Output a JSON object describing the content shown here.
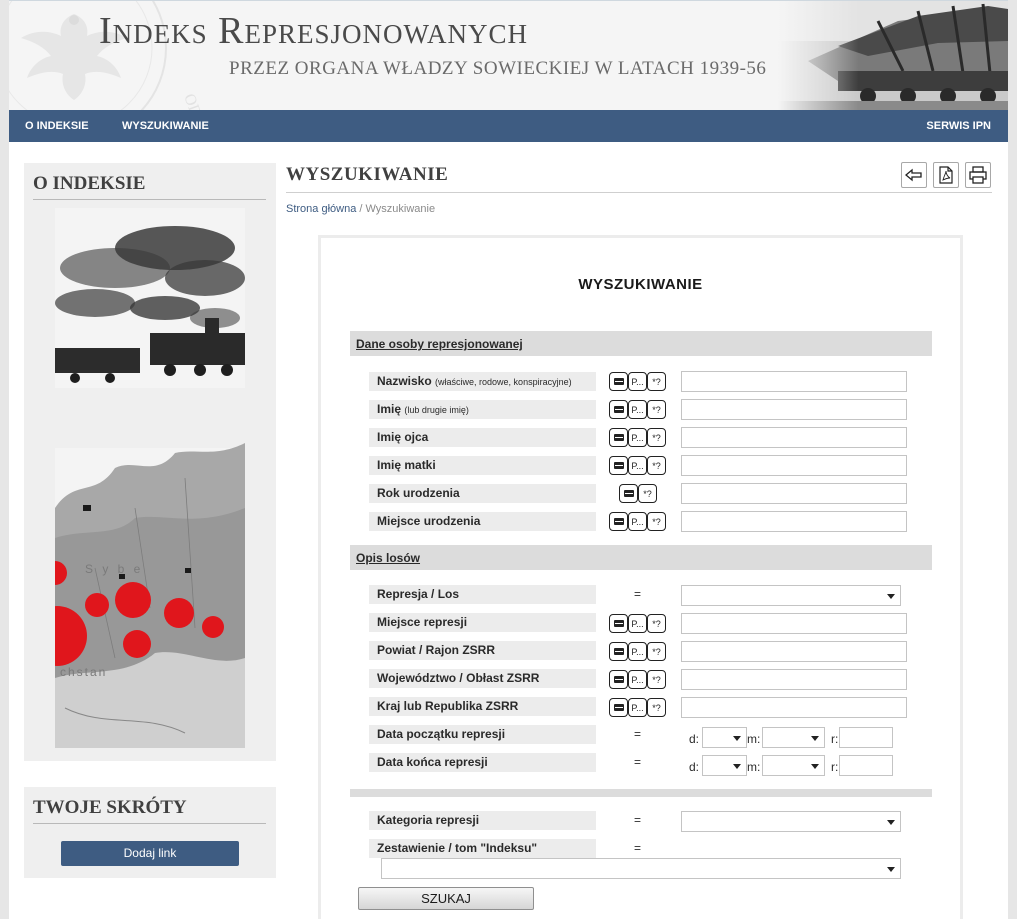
{
  "header": {
    "title": "Indeks Represjonowanych",
    "subtitle": "PRZEZ ORGANA WŁADZY SOWIECKIEJ W LATACH 1939-56"
  },
  "nav": {
    "items": [
      "O INDEKSIE",
      "WYSZUKIWANIE"
    ],
    "right_item": "SERWIS IPN"
  },
  "sidebar": {
    "about_title": "O INDEKSIE",
    "shortcuts_title": "TWOJE SKRÓTY",
    "add_link_label": "Dodaj link",
    "map_words": [
      "S y b e",
      "chstan"
    ]
  },
  "main": {
    "title": "WYSZUKIWANIE",
    "breadcrumb": {
      "home": "Strona główna",
      "separator": "/",
      "current": "Wyszukiwanie"
    },
    "tools": [
      "back-icon",
      "pdf-icon",
      "print-icon"
    ]
  },
  "form": {
    "title": "WYSZUKIWANIE",
    "mode_labels": {
      "exact": "",
      "prefix": "P...",
      "wildcard": "*?"
    },
    "equals_sign": "=",
    "sections": {
      "person": "Dane osoby represjonowanej",
      "fate": "Opis losów"
    },
    "fields": {
      "surname": {
        "label": "Nazwisko",
        "hint": "(właściwe, rodowe, konspiracyjne)",
        "value": ""
      },
      "first_name": {
        "label": "Imię",
        "hint": "(lub drugie imię)",
        "value": ""
      },
      "father_name": {
        "label": "Imię ojca",
        "value": ""
      },
      "mother_name": {
        "label": "Imię matki",
        "value": ""
      },
      "birth_year": {
        "label": "Rok urodzenia",
        "value": ""
      },
      "birth_place": {
        "label": "Miejsce urodzenia",
        "value": ""
      },
      "repression": {
        "label": "Represja / Los",
        "selected": ""
      },
      "repression_place": {
        "label": "Miejsce represji",
        "value": ""
      },
      "district": {
        "label": "Powiat / Rajon ZSRR",
        "value": ""
      },
      "voivodeship": {
        "label": "Województwo / Obłast ZSRR",
        "value": ""
      },
      "country": {
        "label": "Kraj lub Republika ZSRR",
        "value": ""
      },
      "start_date": {
        "label": "Data początku represji"
      },
      "end_date": {
        "label": "Data końca represji"
      },
      "category": {
        "label": "Kategoria represji",
        "selected": ""
      },
      "volume": {
        "label": "Zestawienie / tom \"Indeksu\"",
        "selected": ""
      }
    },
    "date_parts": {
      "day": "d:",
      "month": "m:",
      "year": "r:"
    },
    "search_button": "SZUKAJ"
  },
  "colors": {
    "nav_bg": "#3e5c82",
    "link": "#3e5c82",
    "section_bg": "#dcdcdc",
    "label_bg": "#ececec",
    "repression_marker": "#e0161c"
  }
}
